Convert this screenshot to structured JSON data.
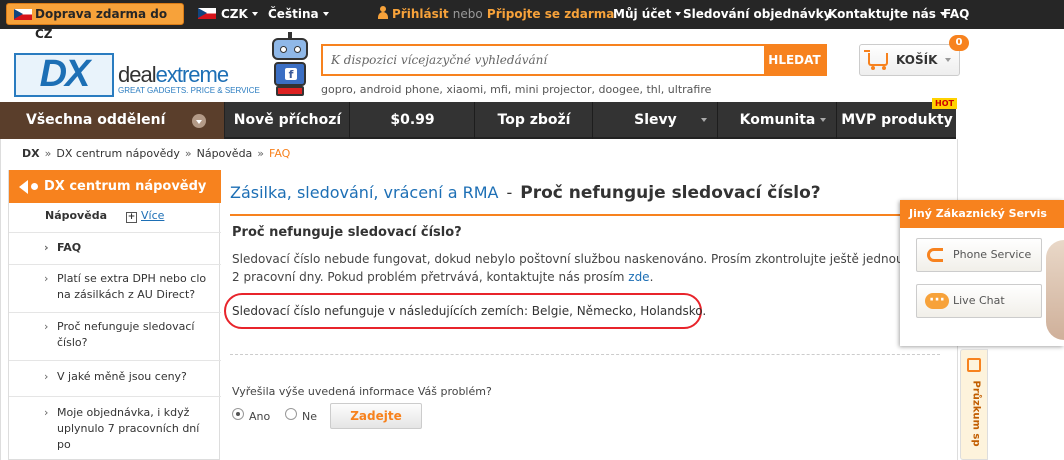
{
  "topbar": {
    "free_shipping": "Doprava zdarma do CZ",
    "currency": "CZK",
    "language": "Čeština",
    "login": "Přihlásit",
    "or": "nebo",
    "register": "Připojte se zdarma",
    "account": "Můj účet",
    "order_tracking": "Sledování objednávky",
    "contact": "Kontaktujte nás",
    "faq": "FAQ"
  },
  "brand": {
    "mark": "DX",
    "name_part1": "deal",
    "name_part2": "extreme",
    "tagline": "GREAT GADGETS. PRICE & SERVICE"
  },
  "search": {
    "placeholder": "K dispozici vícejazyčné vyhledávání",
    "button": "HLEDAT",
    "hot_terms": "gopro, android phone, xiaomi, mfi, mini projector, doogee, thl, ultrafire"
  },
  "cart": {
    "label": "KOŠÍK",
    "count": "0"
  },
  "nav": {
    "departments": "Všechna oddělení",
    "items": [
      "Nově příchozí",
      "$0.99",
      "Top zboží",
      "Slevy",
      "Komunita",
      "MVP produkty"
    ],
    "hot_badge": "HOT"
  },
  "breadcrumb": [
    "DX",
    "DX centrum nápovědy",
    "Nápověda",
    "FAQ"
  ],
  "sidebar": {
    "title": "DX centrum nápovědy",
    "section": "Nápověda",
    "more": "Více",
    "items": [
      "FAQ",
      "Platí se extra DPH nebo clo na zásilkách z AU Direct?",
      "Proč nefunguje sledovací číslo?",
      "V jaké měně jsou ceny?",
      "Moje objednávka, i když uplynulo 7 pracovních dní po"
    ]
  },
  "article": {
    "category": "Zásilka, sledování, vrácení a RMA",
    "dash": "-",
    "title": "Proč nefunguje sledovací číslo?",
    "subtitle": "Proč nefunguje sledovací číslo?",
    "body": "Sledovací číslo nebude fungovat, dokud nebylo poštovní službou naskenováno. Prosím zkontrolujte ještě jednou za 2 pracovní dny. Pokud problém přetrvává, kontaktujte nás prosím",
    "link": "zde",
    "note": "Sledovací číslo nefunguje v následujících zemích: Belgie, Německo, Holandsko."
  },
  "feedback": {
    "question": "Vyřešila výše uvedená informace Váš problém?",
    "yes": "Ano",
    "no": "Ne",
    "yes_selected": true,
    "submit": "Zadejte"
  },
  "customer_service": {
    "title": "Jiný Zákaznický Servis",
    "phone": "Phone Service",
    "chat": "Live Chat"
  },
  "survey": {
    "label": "Průzkum sp"
  },
  "colors": {
    "accent": "#f7821e",
    "link": "#1d6fb5",
    "highlight_ring": "#e8242b"
  }
}
